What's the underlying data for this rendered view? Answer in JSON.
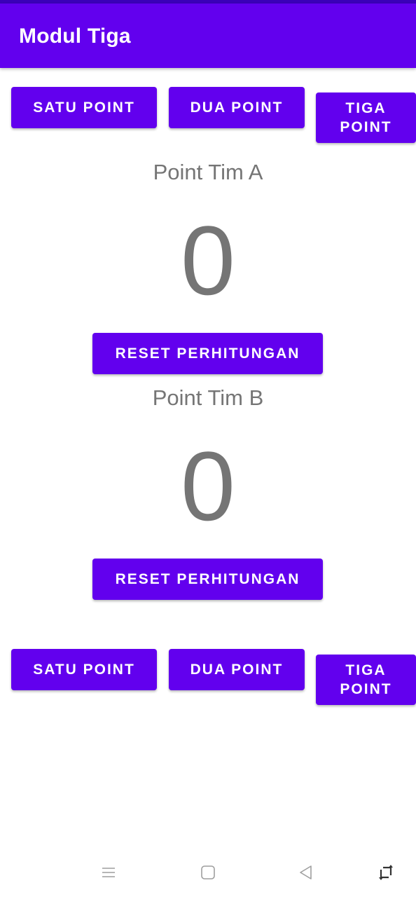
{
  "app_bar": {
    "title": "Modul Tiga"
  },
  "team_a_buttons": {
    "satu_label": "SATU POINT",
    "dua_label": "DUA POINT",
    "tiga_label": "TIGA POINT"
  },
  "team_a": {
    "label": "Point Tim A",
    "score": "0",
    "reset_label": "RESET PERHITUNGAN"
  },
  "team_b": {
    "label": "Point Tim B",
    "score": "0",
    "reset_label": "RESET PERHITUNGAN"
  },
  "team_b_buttons": {
    "satu_label": "SATU POINT",
    "dua_label": "DUA POINT",
    "tiga_label": "TIGA POINT"
  },
  "nav_bar": {
    "icons": [
      "menu-icon",
      "home-icon",
      "back-icon",
      "rotate-icon"
    ]
  },
  "colors": {
    "primary": "#6200ee",
    "text_secondary": "#757575"
  }
}
